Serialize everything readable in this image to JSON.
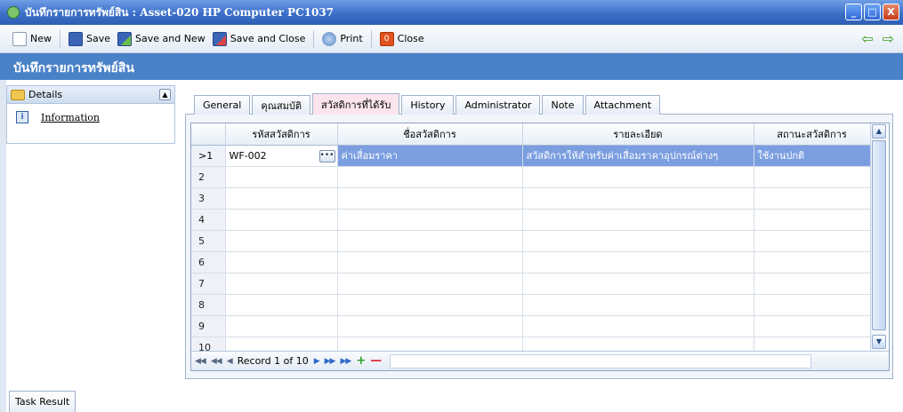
{
  "window": {
    "title": "บันทึกรายการทรัพย์สิน : Asset-020 HP Computer PC1037",
    "min_label": "_",
    "max_label": "□",
    "close_label": "X"
  },
  "toolbar": {
    "new_label": "New",
    "save_label": "Save",
    "save_new_label": "Save and New",
    "save_close_label": "Save and Close",
    "print_label": "Print",
    "close_label": "Close",
    "back_glyph": "⇦",
    "forward_glyph": "⇨"
  },
  "header": {
    "title": "บันทึกรายการทรัพย์สิน"
  },
  "sidebar": {
    "section_label": "Details",
    "collapse_glyph": "▲",
    "items": [
      {
        "label": "Information",
        "icon_glyph": "i"
      }
    ]
  },
  "tabs": [
    {
      "label": "General"
    },
    {
      "label": "คุณสมบัติ"
    },
    {
      "label": "สวัสดิการที่ได้รับ"
    },
    {
      "label": "History"
    },
    {
      "label": "Administrator"
    },
    {
      "label": "Note"
    },
    {
      "label": "Attachment"
    }
  ],
  "grid": {
    "columns": [
      "รหัสสวัสดิการ",
      "ชื่อสวัสดิการ",
      "รายละเอียด",
      "สถานะสวัสดิการ"
    ],
    "rows": [
      {
        "num": ">1",
        "code": "WF-002",
        "name": "ค่าเสื่อมราคา",
        "detail": "สวัสดิการให้สำหรับค่าเสื่อมราคาอุปกรณ์ต่างๆ",
        "status": "ใช้งานปกติ"
      },
      {
        "num": "2",
        "code": "",
        "name": "",
        "detail": "",
        "status": ""
      },
      {
        "num": "3",
        "code": "",
        "name": "",
        "detail": "",
        "status": ""
      },
      {
        "num": "4",
        "code": "",
        "name": "",
        "detail": "",
        "status": ""
      },
      {
        "num": "5",
        "code": "",
        "name": "",
        "detail": "",
        "status": ""
      },
      {
        "num": "6",
        "code": "",
        "name": "",
        "detail": "",
        "status": ""
      },
      {
        "num": "7",
        "code": "",
        "name": "",
        "detail": "",
        "status": ""
      },
      {
        "num": "8",
        "code": "",
        "name": "",
        "detail": "",
        "status": ""
      },
      {
        "num": "9",
        "code": "",
        "name": "",
        "detail": "",
        "status": ""
      },
      {
        "num": "10",
        "code": "",
        "name": "",
        "detail": "",
        "status": ""
      }
    ],
    "ellipsis_glyph": "•••",
    "record_text": "Record 1 of 10",
    "nav": {
      "first": "◀◀",
      "prev_page": "◀◀",
      "prev": "◀",
      "next": "▶",
      "next_page": "▶▶",
      "last": "▶▶",
      "add": "+",
      "remove": "—"
    }
  },
  "bottom": {
    "task_result_label": "Task Result"
  }
}
